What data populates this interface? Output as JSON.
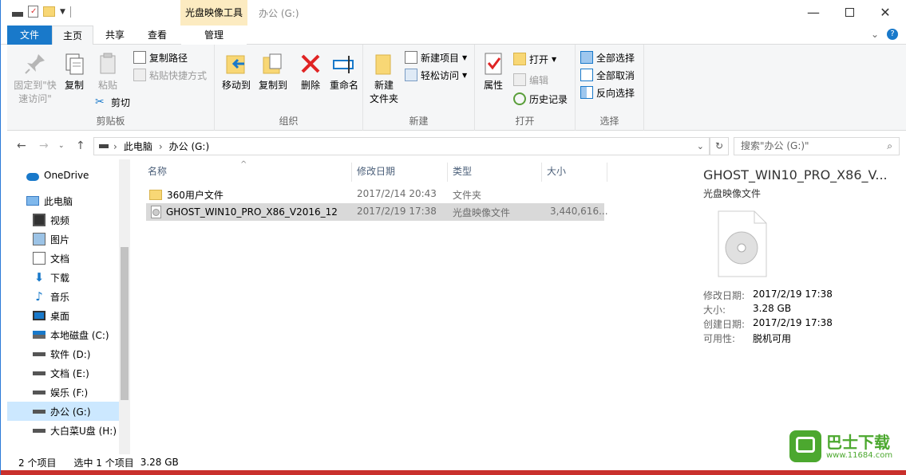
{
  "titlebar": {
    "context_tab": "光盘映像工具",
    "title": "办公 (G:)"
  },
  "tabs": {
    "file": "文件",
    "home": "主页",
    "share": "共享",
    "view": "查看",
    "manage": "管理"
  },
  "ribbon": {
    "clipboard": {
      "pin": "固定到\"快速访问\"",
      "copy": "复制",
      "paste": "粘贴",
      "copy_path": "复制路径",
      "paste_shortcut": "粘贴快捷方式",
      "cut": "剪切",
      "label": "剪贴板"
    },
    "organize": {
      "move_to": "移动到",
      "copy_to": "复制到",
      "delete": "删除",
      "rename": "重命名",
      "label": "组织"
    },
    "new": {
      "new_folder": "新建\n文件夹",
      "new_item": "新建项目",
      "easy_access": "轻松访问",
      "label": "新建"
    },
    "open": {
      "properties": "属性",
      "open": "打开",
      "edit": "编辑",
      "history": "历史记录",
      "label": "打开"
    },
    "select": {
      "select_all": "全部选择",
      "select_none": "全部取消",
      "invert": "反向选择",
      "label": "选择"
    }
  },
  "address": {
    "pc": "此电脑",
    "sep": "›",
    "drive": "办公 (G:)",
    "search_placeholder": "搜索\"办公 (G:)\""
  },
  "nav": {
    "items": [
      {
        "label": "OneDrive",
        "icon": "cloud-icon"
      },
      {
        "label": "此电脑",
        "icon": "computer-icon"
      },
      {
        "label": "视频",
        "icon": "video-icon"
      },
      {
        "label": "图片",
        "icon": "pictures-icon"
      },
      {
        "label": "文档",
        "icon": "documents-icon"
      },
      {
        "label": "下载",
        "icon": "download-icon"
      },
      {
        "label": "音乐",
        "icon": "music-icon"
      },
      {
        "label": "桌面",
        "icon": "desktop-icon"
      },
      {
        "label": "本地磁盘 (C:)",
        "icon": "drive-icon"
      },
      {
        "label": "软件 (D:)",
        "icon": "drive-icon"
      },
      {
        "label": "文档 (E:)",
        "icon": "drive-icon"
      },
      {
        "label": "娱乐 (F:)",
        "icon": "drive-icon"
      },
      {
        "label": "办公 (G:)",
        "icon": "drive-icon"
      },
      {
        "label": "大白菜U盘 (H:)",
        "icon": "drive-icon"
      }
    ]
  },
  "columns": {
    "name": "名称",
    "date": "修改日期",
    "type": "类型",
    "size": "大小"
  },
  "files": [
    {
      "name": "360用户文件",
      "date": "2017/2/14 20:43",
      "type": "文件夹",
      "size": ""
    },
    {
      "name": "GHOST_WIN10_PRO_X86_V2016_12",
      "date": "2017/2/19 17:38",
      "type": "光盘映像文件",
      "size": "3,440,616..."
    }
  ],
  "preview": {
    "title": "GHOST_WIN10_PRO_X86_V...",
    "subtitle": "光盘映像文件",
    "props": [
      {
        "k": "修改日期:",
        "v": "2017/2/19 17:38"
      },
      {
        "k": "大小:",
        "v": "3.28 GB"
      },
      {
        "k": "创建日期:",
        "v": "2017/2/19 17:38"
      },
      {
        "k": "可用性:",
        "v": "脱机可用"
      }
    ]
  },
  "status": {
    "count": "2 个项目",
    "selected": "选中 1 个项目",
    "size": "3.28 GB"
  },
  "watermark": {
    "brand": "巴士下载",
    "url": "www.11684.com"
  },
  "colors": {
    "accent": "#1979ca",
    "selection": "#cce8ff",
    "context": "#fcebc1"
  }
}
